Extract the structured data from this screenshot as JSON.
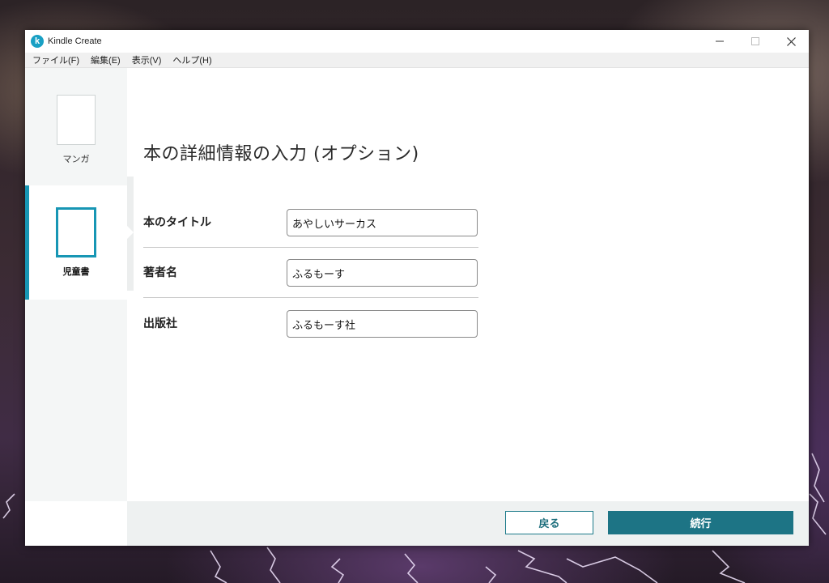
{
  "window": {
    "title": "Kindle Create",
    "logo_letter": "k",
    "controls": [
      "minimize-icon",
      "maximize-icon",
      "close-icon"
    ]
  },
  "menu": {
    "items": [
      "ファイル(F)",
      "編集(E)",
      "表示(V)",
      "ヘルプ(H)"
    ]
  },
  "sidebar": {
    "items": [
      {
        "label": "マンガ",
        "selected": false
      },
      {
        "label": "児童書",
        "selected": true
      }
    ]
  },
  "page": {
    "title": "本の詳細情報の入力 (オプション)"
  },
  "form": {
    "fields": [
      {
        "label": "本のタイトル",
        "value": "あやしいサーカス"
      },
      {
        "label": "著者名",
        "value": "ふるもーす"
      },
      {
        "label": "出版社",
        "value": "ふるもーす社"
      }
    ]
  },
  "footer": {
    "back_label": "戻る",
    "continue_label": "続行"
  },
  "colors": {
    "accent": "#1796b4",
    "primary_button": "#1d7485"
  }
}
